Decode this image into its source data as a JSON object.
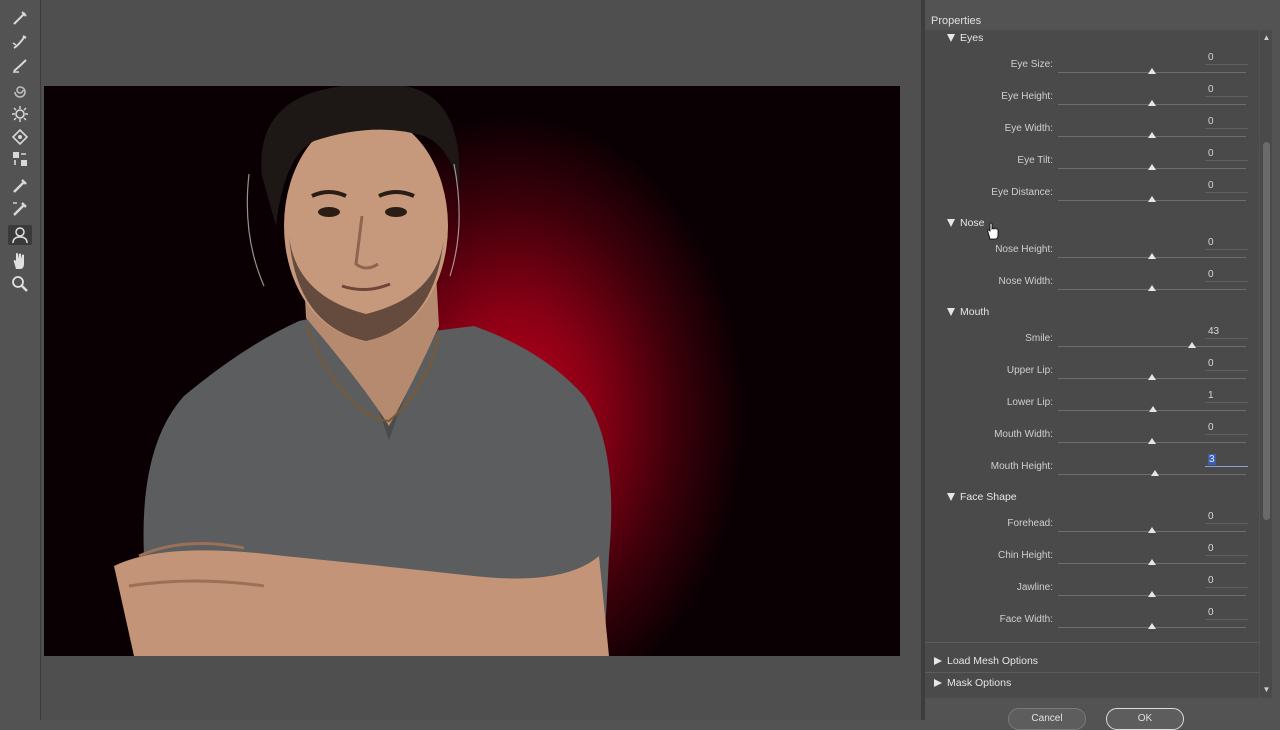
{
  "toolbar": {
    "tools": [
      {
        "name": "forward-warp-tool-icon"
      },
      {
        "name": "reconstruct-tool-icon"
      },
      {
        "name": "smooth-tool-icon"
      },
      {
        "name": "twirl-tool-icon"
      },
      {
        "name": "pucker-tool-icon"
      },
      {
        "name": "bloat-tool-icon"
      },
      {
        "name": "push-left-tool-icon"
      },
      {
        "name": "freeze-mask-tool-icon"
      },
      {
        "name": "thaw-mask-tool-icon"
      },
      {
        "name": "face-tool-icon"
      },
      {
        "name": "hand-tool-icon"
      },
      {
        "name": "zoom-tool-icon"
      }
    ],
    "active_tool": "face-tool-icon"
  },
  "panel": {
    "title": "Properties",
    "sections": [
      {
        "title": "Eyes",
        "sliders": [
          {
            "label": "Eye Size:",
            "value": "0",
            "fraction": 0.5
          },
          {
            "label": "Eye Height:",
            "value": "0",
            "fraction": 0.5
          },
          {
            "label": "Eye Width:",
            "value": "0",
            "fraction": 0.5
          },
          {
            "label": "Eye Tilt:",
            "value": "0",
            "fraction": 0.5
          },
          {
            "label": "Eye Distance:",
            "value": "0",
            "fraction": 0.5
          }
        ]
      },
      {
        "title": "Nose",
        "sliders": [
          {
            "label": "Nose Height:",
            "value": "0",
            "fraction": 0.5
          },
          {
            "label": "Nose Width:",
            "value": "0",
            "fraction": 0.5
          }
        ]
      },
      {
        "title": "Mouth",
        "sliders": [
          {
            "label": "Smile:",
            "value": "43",
            "fraction": 0.715
          },
          {
            "label": "Upper Lip:",
            "value": "0",
            "fraction": 0.5
          },
          {
            "label": "Lower Lip:",
            "value": "1",
            "fraction": 0.505
          },
          {
            "label": "Mouth Width:",
            "value": "0",
            "fraction": 0.5
          },
          {
            "label": "Mouth Height:",
            "value": "3",
            "fraction": 0.515,
            "active": true
          }
        ]
      },
      {
        "title": "Face Shape",
        "sliders": [
          {
            "label": "Forehead:",
            "value": "0",
            "fraction": 0.5
          },
          {
            "label": "Chin Height:",
            "value": "0",
            "fraction": 0.5
          },
          {
            "label": "Jawline:",
            "value": "0",
            "fraction": 0.5
          },
          {
            "label": "Face Width:",
            "value": "0",
            "fraction": 0.5
          }
        ]
      }
    ],
    "collapsed": [
      {
        "title": "Load Mesh Options"
      },
      {
        "title": "Mask Options"
      }
    ]
  },
  "buttons": {
    "cancel": "Cancel",
    "ok": "OK"
  }
}
